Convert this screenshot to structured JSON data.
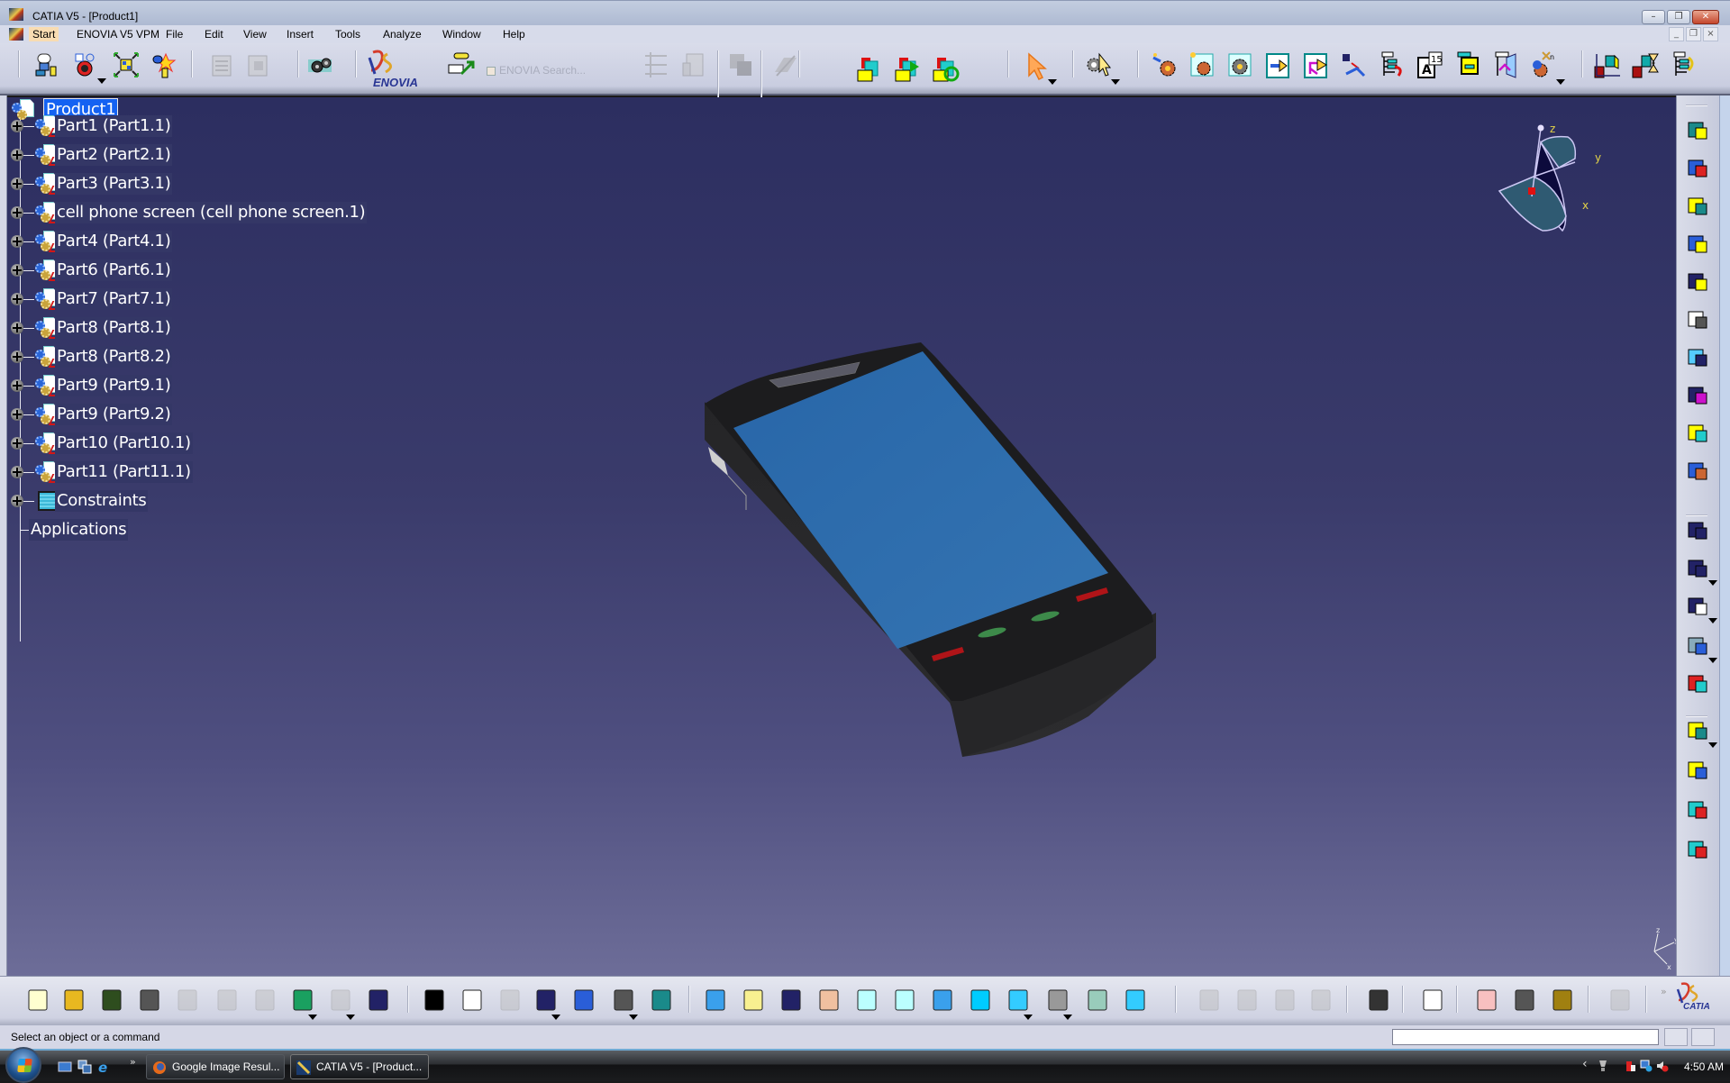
{
  "window": {
    "title": "CATIA V5 - [Product1]",
    "controls": {
      "minimize": "–",
      "restore": "❐",
      "close": "✕"
    }
  },
  "menu": {
    "items": [
      {
        "label": "Start",
        "active": true
      },
      {
        "label": "ENOVIA V5 VPM"
      },
      {
        "label": "File"
      },
      {
        "label": "Edit"
      },
      {
        "label": "View"
      },
      {
        "label": "Insert"
      },
      {
        "label": "Tools"
      },
      {
        "label": "Analyze"
      },
      {
        "label": "Window"
      },
      {
        "label": "Help"
      }
    ],
    "doc_controls": {
      "minimize": "_",
      "restore": "❐",
      "close": "×"
    }
  },
  "top_toolbar": {
    "enovia_logo": "ENOVIA",
    "enovia_search_label": "ENOVIA Search...",
    "icons": [
      "catalog-browser",
      "product-manager",
      "fit-assembly",
      "new-component",
      "disabled-doc-1",
      "disabled-doc-2",
      "gear-settings",
      "enovia-logo",
      "enovia-send",
      "disabled-1",
      "disabled-2",
      "disabled-3",
      "disabled-4",
      "save-management",
      "send-to",
      "refresh-link",
      "select-arrow",
      "knowledge-select",
      "existing-component",
      "existing-component-positioning",
      "replace-component",
      "graph-tree-reorder",
      "generate-numbering",
      "bill-of-material",
      "selective-load",
      "manage-representations",
      "multi-instantiation",
      "fast-multi-instantiation",
      "reorder-tree",
      "publication",
      "flexible-sub-assembly",
      "reorder-graph"
    ]
  },
  "tree": {
    "root": "Product1",
    "children": [
      {
        "label": "Part1 (Part1.1)"
      },
      {
        "label": "Part2 (Part2.1)"
      },
      {
        "label": "Part3 (Part3.1)"
      },
      {
        "label": "cell phone screen (cell phone screen.1)"
      },
      {
        "label": "Part4 (Part4.1)"
      },
      {
        "label": "Part6 (Part6.1)"
      },
      {
        "label": "Part7 (Part7.1)"
      },
      {
        "label": "Part8 (Part8.1)"
      },
      {
        "label": "Part8 (Part8.2)"
      },
      {
        "label": "Part9 (Part9.1)"
      },
      {
        "label": "Part9 (Part9.2)"
      },
      {
        "label": "Part10 (Part10.1)"
      },
      {
        "label": "Part11 (Part11.1)"
      },
      {
        "label": "Constraints",
        "type": "constraints"
      },
      {
        "label": "Applications",
        "type": "applications"
      }
    ]
  },
  "compass": {
    "axes": [
      "z",
      "y",
      "x"
    ]
  },
  "mini_axis": {
    "axes": [
      "z",
      "y",
      "x"
    ]
  },
  "model": {
    "name": "cell phone",
    "colors": {
      "body": "#1e1e20",
      "screen": "#2a6cad",
      "red_buttons": "#b01418",
      "green_buttons": "#3d8a4a",
      "speaker": "#5a5a66"
    }
  },
  "right_toolbar": {
    "icons": [
      "space-analysis",
      "sectioning",
      "clash",
      "distance-band",
      "anchor",
      "paperclip-snap",
      "manipulation",
      "explode",
      "stop-manipulate",
      "fix-together",
      "constraint-contact",
      "constraint-offset",
      "constraint-angle",
      "constraint-fix",
      "reconnect",
      "update",
      "change-constraint",
      "tree-compact",
      "tree-expand"
    ]
  },
  "bottom_toolbar": {
    "icons": [
      "new",
      "open",
      "save",
      "print",
      "cut",
      "copy",
      "paste",
      "undo",
      "redo",
      "whats-this",
      "formula",
      "comment",
      "link",
      "table",
      "parameters",
      "lock",
      "equations",
      "fly-mode",
      "fit-all",
      "pan",
      "rotate",
      "zoom-in",
      "zoom-out",
      "normal-view",
      "multi-view",
      "isometric-view",
      "shading",
      "hide-show",
      "swap-visible-space",
      "dismiss",
      "spawn",
      "comments-1",
      "comments-2",
      "capture",
      "macro",
      "measure-between",
      "measure-item",
      "measure-inertia",
      "update-all"
    ],
    "catia_logo": "CATIA",
    "more": "»"
  },
  "status": {
    "message": "Select an object or a command",
    "command_input": ""
  },
  "taskbar": {
    "more": "»",
    "tasks": [
      {
        "label": "Google Image Resul...",
        "active": false
      },
      {
        "label": "CATIA V5 - [Product...",
        "active": true
      }
    ],
    "clock": "4:50 AM",
    "tray_expand": "‹"
  },
  "theme": {
    "viewport_top": "#2c2e60",
    "viewport_bottom": "#6d6d98",
    "selection": "#1462f2",
    "toolbar_bg": "#d7dbea"
  }
}
